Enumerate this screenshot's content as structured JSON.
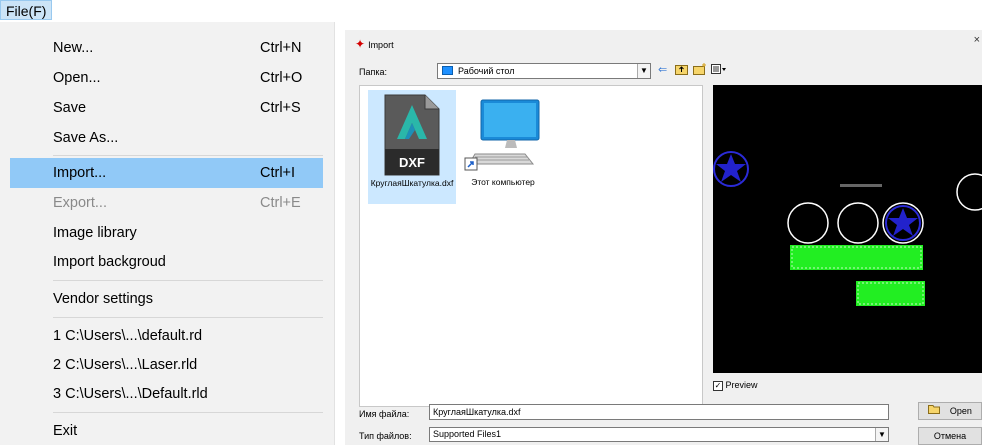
{
  "menubar": {
    "file_label": "File(F)"
  },
  "file_menu": {
    "items": [
      {
        "label": "New...",
        "shortcut": "Ctrl+N"
      },
      {
        "label": "Open...",
        "shortcut": "Ctrl+O"
      },
      {
        "label": "Save",
        "shortcut": "Ctrl+S"
      },
      {
        "label": "Save As...",
        "shortcut": ""
      },
      {
        "label": "Import...",
        "shortcut": "Ctrl+I"
      },
      {
        "label": "Export...",
        "shortcut": "Ctrl+E"
      },
      {
        "label": "Image library",
        "shortcut": ""
      },
      {
        "label": "Import backgroud",
        "shortcut": ""
      },
      {
        "label": "Vendor settings",
        "shortcut": ""
      },
      {
        "label": "1 C:\\Users\\...\\default.rd",
        "shortcut": ""
      },
      {
        "label": "2 C:\\Users\\...\\Laser.rld",
        "shortcut": ""
      },
      {
        "label": "3 C:\\Users\\...\\Default.rld",
        "shortcut": ""
      },
      {
        "label": "Exit",
        "shortcut": ""
      }
    ]
  },
  "dialog": {
    "title": "Import",
    "close": "×",
    "folder_label": "Папка:",
    "folder_value": "Рабочий стол",
    "toolbar_icons": [
      "back-arrow-icon",
      "up-folder-icon",
      "new-folder-icon",
      "view-menu-icon"
    ],
    "files": [
      {
        "name": "КруглаяШкатулка.dxf",
        "badge": "DXF",
        "icon": "dxf-file-icon"
      },
      {
        "name": "Этот компьютер",
        "icon": "computer-icon"
      }
    ],
    "preview_label": "Preview",
    "preview_checked": true,
    "filename_label": "Имя файла:",
    "filename_value": "КруглаяШкатулка.dxf",
    "filetype_label": "Тип файлов:",
    "filetype_value": "Supported Files1",
    "open_button": "Open",
    "cancel_button": "Отмена"
  },
  "colors": {
    "menu_highlight": "#91c9f7",
    "preview_bg": "#000000",
    "preview_green": "#22ee22",
    "preview_blue": "#2222cc"
  }
}
